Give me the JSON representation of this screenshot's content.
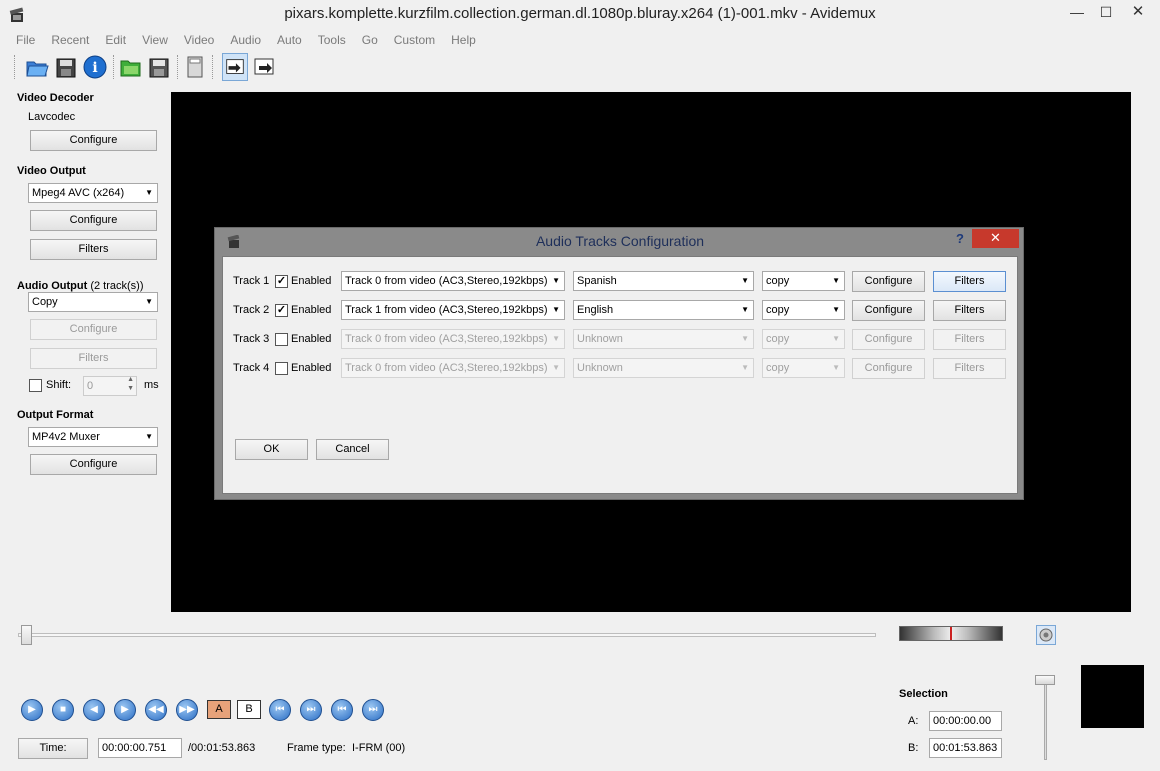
{
  "window": {
    "title": "pixars.komplette.kurzfilm.collection.german.dl.1080p.bluray.x264 (1)-001.mkv - Avidemux",
    "min_glyph": "—",
    "max_glyph": "☐",
    "close_glyph": "✕"
  },
  "menu": [
    "File",
    "Recent",
    "Edit",
    "View",
    "Video",
    "Audio",
    "Auto",
    "Tools",
    "Go",
    "Custom",
    "Help"
  ],
  "left_panel": {
    "video_decoder": {
      "title": "Video Decoder",
      "codec": "Lavcodec",
      "configure": "Configure"
    },
    "video_output": {
      "title": "Video Output",
      "selected": "Mpeg4 AVC (x264)",
      "configure": "Configure",
      "filters": "Filters"
    },
    "audio_output": {
      "title": "Audio Output",
      "track_count": "(2 track(s))",
      "selected": "Copy",
      "configure": "Configure",
      "filters": "Filters",
      "shift_label": "Shift:",
      "shift_value": "0",
      "shift_unit": "ms"
    },
    "output_format": {
      "title": "Output Format",
      "selected": "MP4v2 Muxer",
      "configure": "Configure"
    }
  },
  "dialog": {
    "title": "Audio Tracks Configuration",
    "help": "?",
    "close": "✕",
    "enabled_label": "Enabled",
    "configure": "Configure",
    "filters": "Filters",
    "tracks": [
      {
        "label": "Track 1",
        "enabled": true,
        "source": "Track 0 from video (AC3,Stereo,192kbps)",
        "language": "Spanish",
        "codec": "copy"
      },
      {
        "label": "Track 2",
        "enabled": true,
        "source": "Track 1 from video (AC3,Stereo,192kbps)",
        "language": "English",
        "codec": "copy"
      },
      {
        "label": "Track 3",
        "enabled": false,
        "source": "Track 0 from video (AC3,Stereo,192kbps)",
        "language": "Unknown",
        "codec": "copy"
      },
      {
        "label": "Track 4",
        "enabled": false,
        "source": "Track 0 from video (AC3,Stereo,192kbps)",
        "language": "Unknown",
        "codec": "copy"
      }
    ],
    "ok": "OK",
    "cancel": "Cancel"
  },
  "bottom": {
    "time_button": "Time:",
    "current_time": "00:00:00.751",
    "total_time": "/00:01:53.863",
    "frame_type_label": "Frame type:",
    "frame_type": "I-FRM (00)",
    "selection_title": "Selection",
    "a_label": "A:",
    "a_value": "00:00:00.00",
    "b_label": "B:",
    "b_value": "00:01:53.863",
    "marker_a": "A",
    "marker_b": "B"
  }
}
